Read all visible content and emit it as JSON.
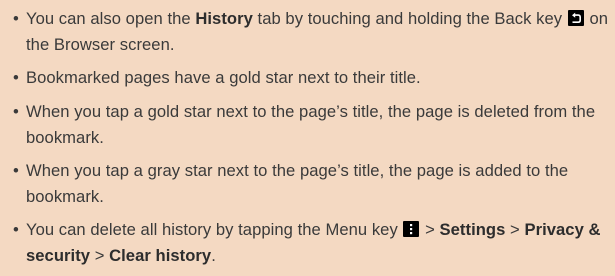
{
  "notes": {
    "bullet": "•",
    "n1": {
      "t1": "You can also open the ",
      "b1": "History",
      "t2": " tab by touching and holding the Back key ",
      "t3": " on the Browser screen."
    },
    "n2": {
      "t1": "Bookmarked pages have a gold star next to their title."
    },
    "n3": {
      "t1": "When you tap a gold star next to the page’s title, the page is deleted from the bookmark."
    },
    "n4": {
      "t1": "When you tap a gray star next to the page’s title, the page is added to the bookmark."
    },
    "n5": {
      "t1": "You can delete all history by tapping the Menu key ",
      "t2": " > ",
      "b1": "Settings",
      "t3": " > ",
      "b2": "Privacy & security",
      "t4": " > ",
      "b3": "Clear history",
      "t5": "."
    }
  },
  "icons": {
    "back_key": "back-key-icon",
    "menu_key": "menu-key-icon"
  },
  "colors": {
    "background": "#f4d9c2",
    "text": "#3a3a3a",
    "key_icon": "#000000"
  }
}
